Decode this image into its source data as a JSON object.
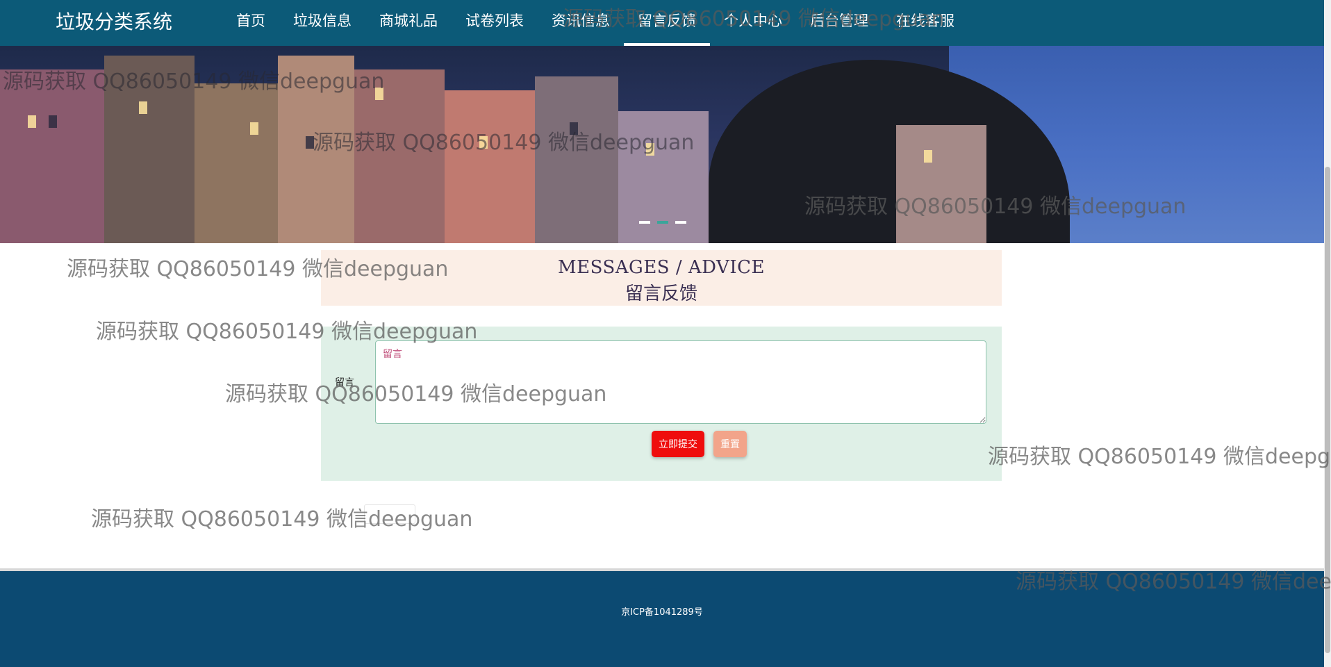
{
  "header": {
    "brand": "垃圾分类系统",
    "nav": [
      {
        "label": "首页"
      },
      {
        "label": "垃圾信息"
      },
      {
        "label": "商城礼品"
      },
      {
        "label": "试卷列表"
      },
      {
        "label": "资讯信息"
      },
      {
        "label": "留言反馈",
        "active": true
      },
      {
        "label": "个人中心"
      },
      {
        "label": "后台管理"
      },
      {
        "label": "在线客服"
      }
    ]
  },
  "banner": {
    "slides": 3,
    "active_slide": 2
  },
  "section": {
    "title_en": "MESSAGES / ADVICE",
    "title_cn": "留言反馈"
  },
  "form": {
    "label": "留言",
    "placeholder": "留言",
    "value": "",
    "submit_label": "立即提交",
    "reset_label": "重置"
  },
  "footer": {
    "icp": "京ICP备1041289号"
  },
  "watermark_text": "源码获取 QQ86050149 微信deepguan",
  "colors": {
    "nav_bg": "#0c5a78",
    "footer_bg": "#0c4a72",
    "title_card_bg": "#fbeee6",
    "form_card_bg": "#dff0e7",
    "submit": "#ef0d0d",
    "reset": "#f2a48a"
  }
}
